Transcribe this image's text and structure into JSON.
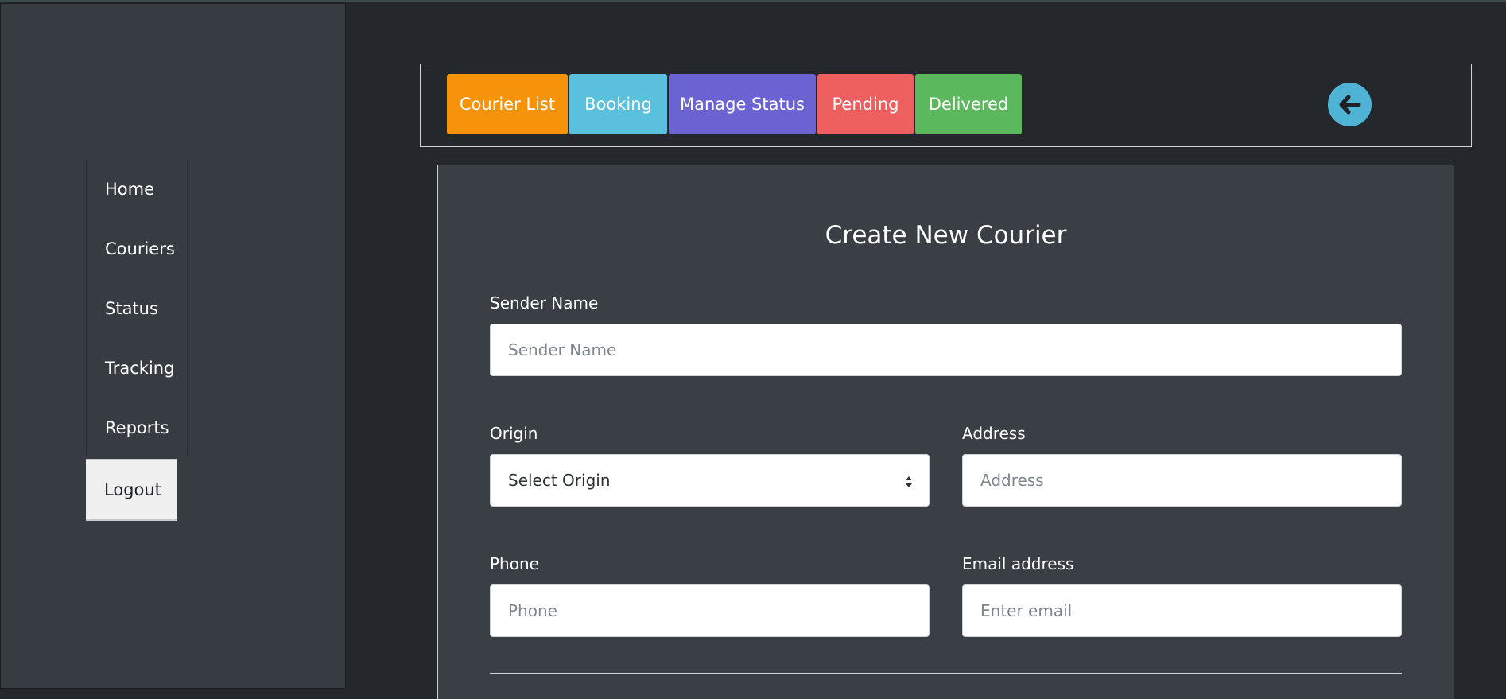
{
  "sidebar": {
    "items": [
      {
        "label": "Home"
      },
      {
        "label": "Couriers"
      },
      {
        "label": "Status"
      },
      {
        "label": "Tracking"
      },
      {
        "label": "Reports"
      }
    ],
    "logout_label": "Logout"
  },
  "toolbar": {
    "tabs": [
      {
        "label": "Courier List",
        "color": "#f7930b"
      },
      {
        "label": "Booking",
        "color": "#5bc0de"
      },
      {
        "label": "Manage Status",
        "color": "#6b63d1"
      },
      {
        "label": "Pending",
        "color": "#ee5f5f"
      },
      {
        "label": "Delivered",
        "color": "#5cb85c"
      }
    ],
    "back_icon": "arrow-left-circle-icon"
  },
  "form": {
    "title": "Create New Courier",
    "sender_name": {
      "label": "Sender Name",
      "placeholder": "Sender Name",
      "value": ""
    },
    "origin": {
      "label": "Origin",
      "selected": "Select Origin"
    },
    "address": {
      "label": "Address",
      "placeholder": "Address",
      "value": ""
    },
    "phone": {
      "label": "Phone",
      "placeholder": "Phone",
      "value": ""
    },
    "email": {
      "label": "Email address",
      "placeholder": "Enter email",
      "value": ""
    }
  }
}
